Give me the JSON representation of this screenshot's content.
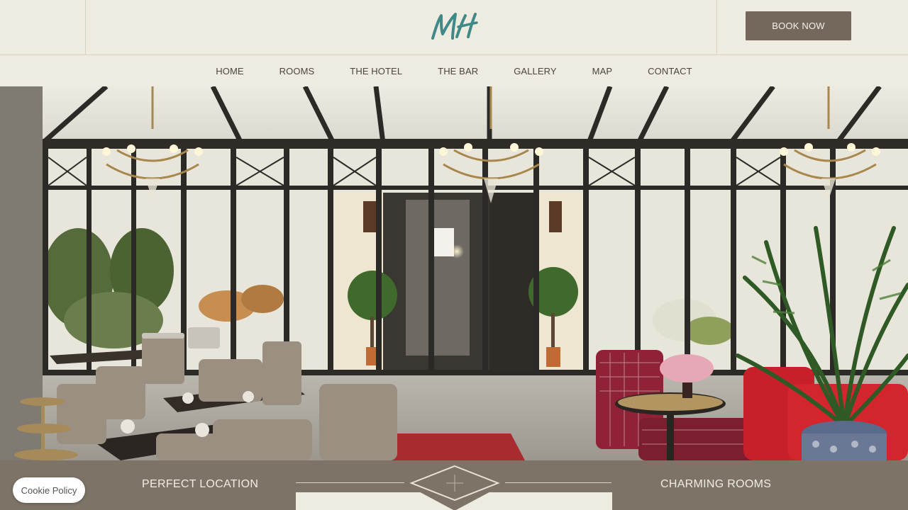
{
  "header": {
    "logo_text": "MH",
    "book_label": "BOOK NOW"
  },
  "nav": {
    "items": [
      "HOME",
      "ROOMS",
      "THE HOTEL",
      "THE BAR",
      "GALLERY",
      "MAP",
      "CONTACT"
    ]
  },
  "hero": {
    "image_icon": "conservatory-photo"
  },
  "band": {
    "left_label": "PERFECT LOCATION",
    "right_label": "CHARMING ROOMS"
  },
  "cookie": {
    "label": "Cookie Policy"
  },
  "colors": {
    "background": "#eeebe0",
    "brand_teal": "#3f8a88",
    "button": "#74685c",
    "band": "#7d7366"
  }
}
